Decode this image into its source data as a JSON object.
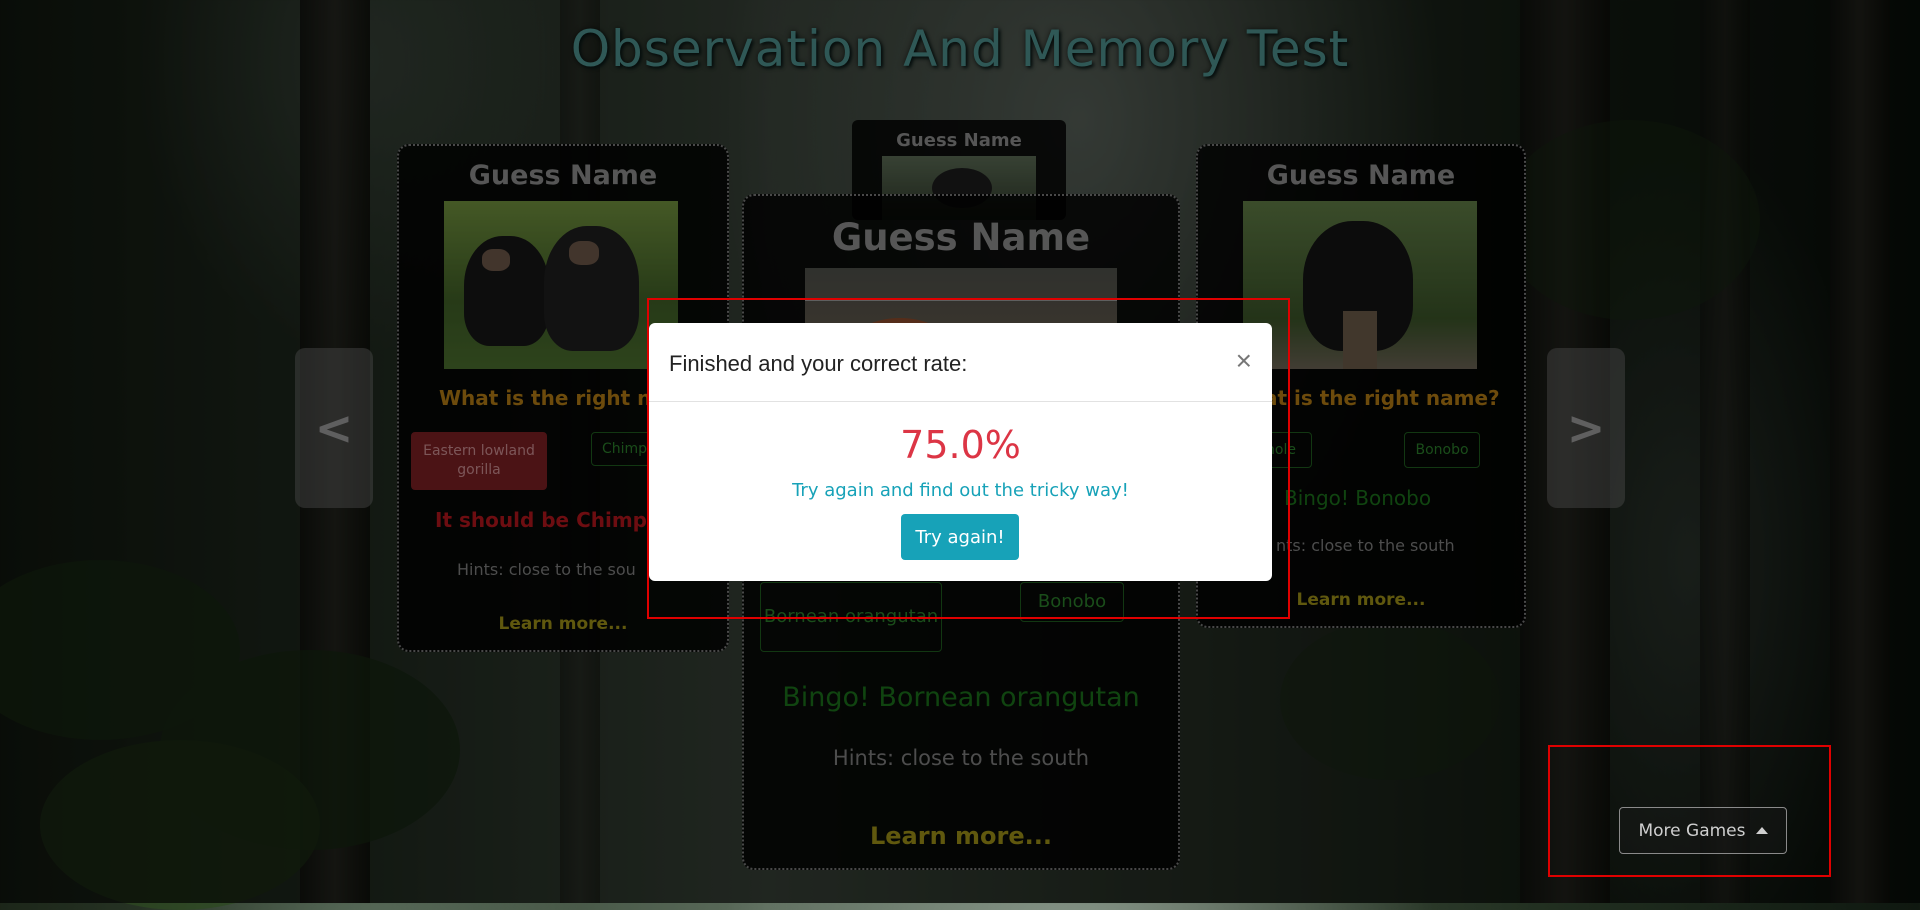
{
  "header": {
    "title": "Observation And Memory Test"
  },
  "carousel": {
    "prev_label": "<",
    "next_label": ">",
    "cards": {
      "left": {
        "title": "Guess Name",
        "image": "chimpanzee-photo",
        "question": "What is the right nar",
        "options": [
          "Eastern lowland gorilla",
          "Chimp"
        ],
        "result": "It should be Chimpar",
        "hint": "Hints: close to the sou",
        "learn_more": "Learn more..."
      },
      "back": {
        "title": "Guess Name",
        "image": "gorilla-photo"
      },
      "center": {
        "title": "Guess Name",
        "image": "orangutan-photo",
        "options": [
          "Bornean orangutan",
          "Bonobo"
        ],
        "result": "Bingo! Bornean orangutan",
        "hint": "Hints: close to the south",
        "learn_more": "Learn more..."
      },
      "right": {
        "title": "Guess Name",
        "image": "bonobo-photo",
        "question": "at is the right name?",
        "options": [
          "nole",
          "Bonobo"
        ],
        "result": "Bingo! Bonobo",
        "hint": "nts: close to the south",
        "learn_more": "Learn more..."
      }
    }
  },
  "modal": {
    "title": "Finished and your correct rate:",
    "close_label": "×",
    "score": "75.0%",
    "message": "Try again and find out the tricky way!",
    "button_label": "Try again!"
  },
  "more_games": {
    "label": "More Games"
  },
  "colors": {
    "score": "#dc3545",
    "info": "#17a2b8",
    "highlight_box": "#e00000",
    "wrong_answer": "#7a1f23",
    "correct_text": "#1a6e1a"
  }
}
